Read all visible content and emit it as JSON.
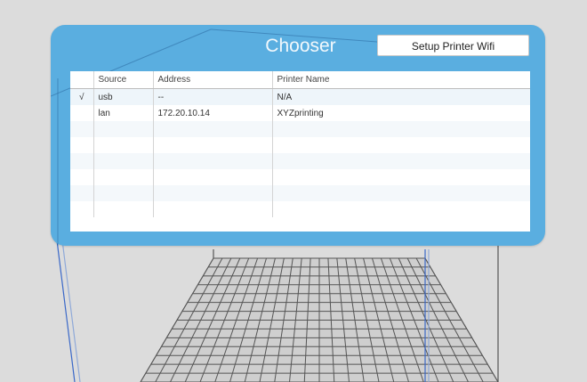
{
  "window": {
    "title": "Chooser",
    "setup_button_label": "Setup Printer Wifi"
  },
  "table": {
    "columns": [
      "",
      "Source",
      "Address",
      "Printer Name"
    ],
    "rows": [
      {
        "check": "√",
        "source": "usb",
        "address": "--",
        "printer_name": "N/A"
      },
      {
        "check": "",
        "source": "lan",
        "address": "172.20.10.14",
        "printer_name": "XYZprinting"
      },
      {
        "check": "",
        "source": "",
        "address": "",
        "printer_name": ""
      },
      {
        "check": "",
        "source": "",
        "address": "",
        "printer_name": ""
      },
      {
        "check": "",
        "source": "",
        "address": "",
        "printer_name": ""
      },
      {
        "check": "",
        "source": "",
        "address": "",
        "printer_name": ""
      },
      {
        "check": "",
        "source": "",
        "address": "",
        "printer_name": ""
      },
      {
        "check": "",
        "source": "",
        "address": "",
        "printer_name": ""
      }
    ]
  },
  "colors": {
    "panel": "#5aaee0",
    "background": "#dcdcdc",
    "grid": "#555555",
    "wire_blue": "#3a68c8"
  }
}
